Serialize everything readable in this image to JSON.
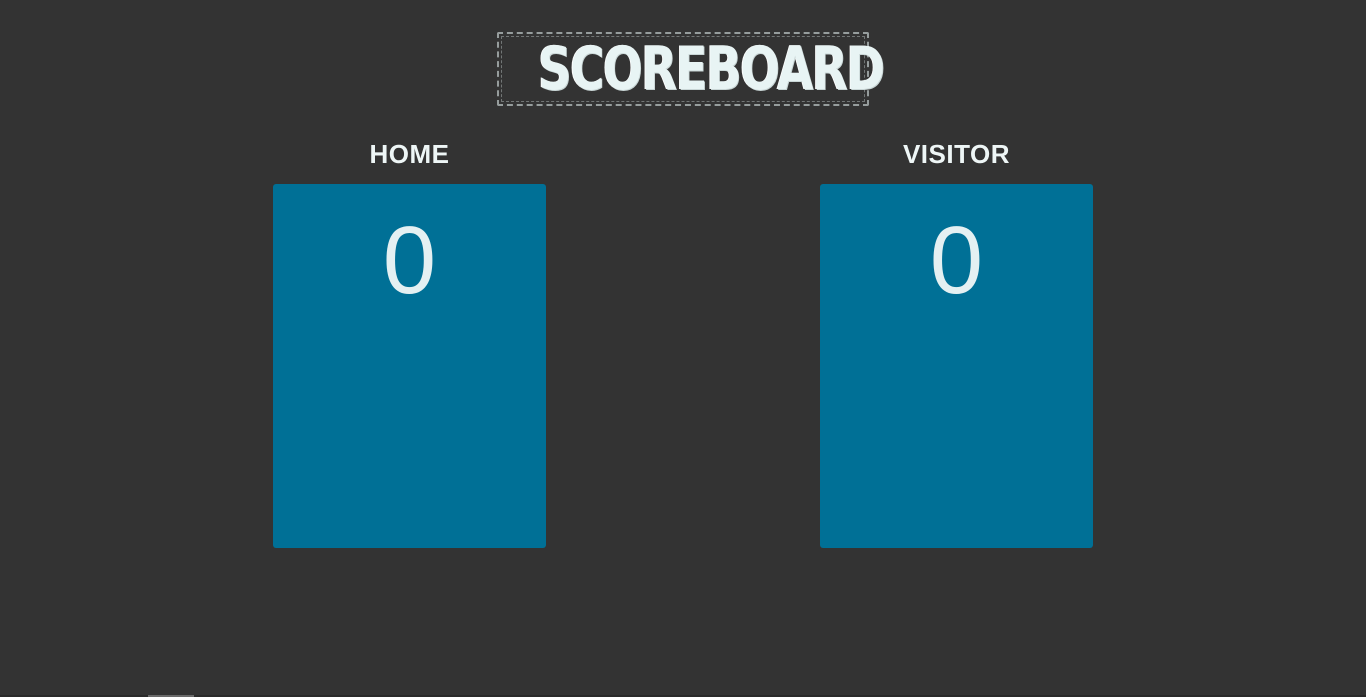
{
  "header": {
    "title": "SCOREBOARD"
  },
  "teams": {
    "home": {
      "label": "HOME",
      "score": "0"
    },
    "visitor": {
      "label": "VISITOR",
      "score": "0"
    }
  },
  "colors": {
    "background": "#333333",
    "score_box": "#007096",
    "text": "#eef6f6"
  }
}
